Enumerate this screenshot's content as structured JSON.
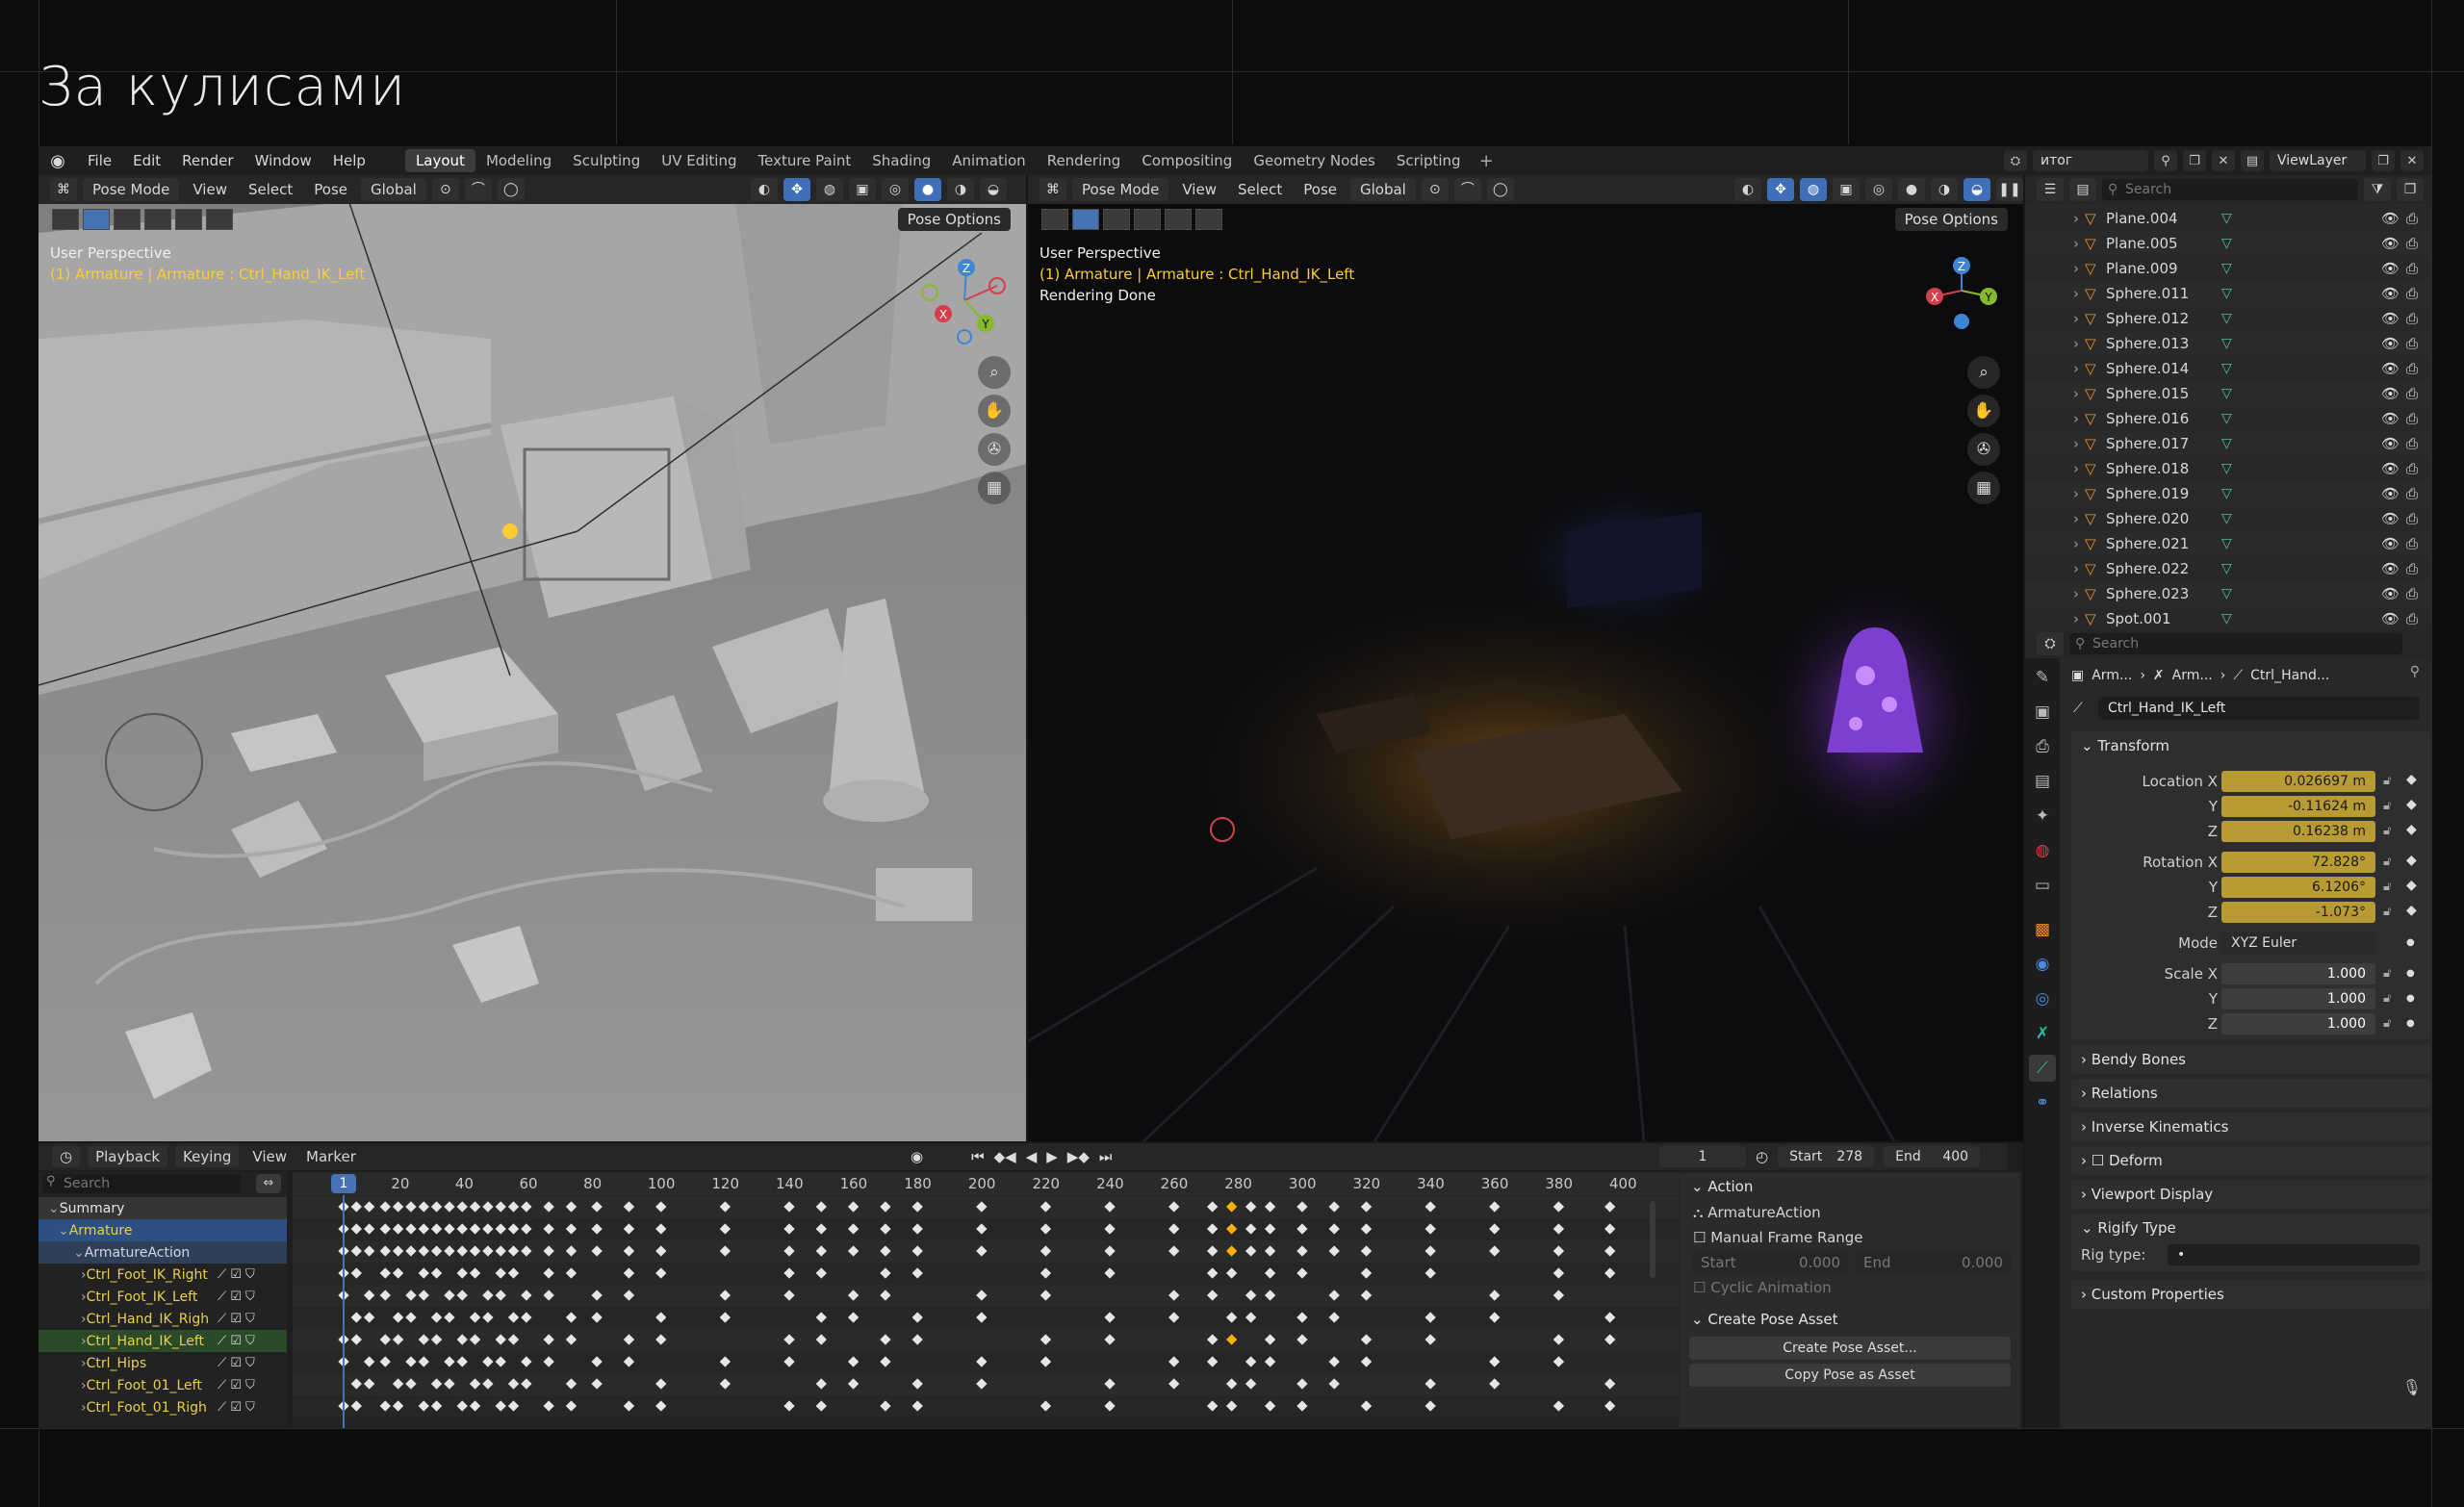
{
  "page": {
    "title": "За кулисами"
  },
  "menu": {
    "items": [
      "File",
      "Edit",
      "Render",
      "Window",
      "Help"
    ],
    "workspaces": [
      "Layout",
      "Modeling",
      "Sculpting",
      "UV Editing",
      "Texture Paint",
      "Shading",
      "Animation",
      "Rendering",
      "Compositing",
      "Geometry Nodes",
      "Scripting"
    ],
    "active_workspace": "Layout",
    "scene": "итог",
    "view_layer": "ViewLayer"
  },
  "viewport_left": {
    "mode": "Pose Mode",
    "menus": [
      "View",
      "Select",
      "Pose"
    ],
    "orientation": "Global",
    "pose_options": "Pose Options",
    "perspective": "User Perspective",
    "object_info": "(1) Armature | Armature : Ctrl_Hand_IK_Left"
  },
  "viewport_right": {
    "mode": "Pose Mode",
    "menus": [
      "View",
      "Select",
      "Pose"
    ],
    "orientation": "Global",
    "pose_options": "Pose Options",
    "perspective": "User Perspective",
    "object_info": "(1) Armature | Armature : Ctrl_Hand_IK_Left",
    "status": "Rendering Done"
  },
  "gizmo": {
    "z": "Z",
    "y": "Y",
    "x": "X",
    "colors": {
      "x": "#d33f4c",
      "y": "#86b92b",
      "z": "#3d86d6"
    }
  },
  "timeline": {
    "menus": [
      "Playback",
      "Keying",
      "View",
      "Marker"
    ],
    "current_frame": "1",
    "start_label": "Start",
    "start": "278",
    "end_label": "End",
    "end": "400",
    "search_placeholder": "Search",
    "playhead": "1",
    "ticks": [
      "20",
      "40",
      "60",
      "80",
      "100",
      "120",
      "140",
      "160",
      "180",
      "200",
      "220",
      "240",
      "260",
      "280",
      "300",
      "320",
      "340",
      "360",
      "380",
      "400"
    ],
    "channels": [
      "Summary",
      "Armature",
      "ArmatureAction",
      "Ctrl_Foot_IK_Right",
      "Ctrl_Foot_IK_Left",
      "Ctrl_Hand_IK_Righ",
      "Ctrl_Hand_IK_Left",
      "Ctrl_Hips",
      "Ctrl_Foot_01_Left",
      "Ctrl_Foot_01_Righ"
    ]
  },
  "action_panel": {
    "title": "Action",
    "action_name": "ArmatureAction",
    "manual_range": "Manual Frame Range",
    "start_label": "Start",
    "start": "0.000",
    "end_label": "End",
    "end": "0.000",
    "cyclic": "Cyclic Animation",
    "pose_asset_title": "Create Pose Asset",
    "create_pose": "Create Pose Asset...",
    "copy_pose": "Copy Pose as Asset"
  },
  "outliner": {
    "search_placeholder": "Search",
    "items": [
      "Plane.004",
      "Plane.005",
      "Plane.009",
      "Sphere.011",
      "Sphere.012",
      "Sphere.013",
      "Sphere.014",
      "Sphere.015",
      "Sphere.016",
      "Sphere.017",
      "Sphere.018",
      "Sphere.019",
      "Sphere.020",
      "Sphere.021",
      "Sphere.022",
      "Sphere.023",
      "Spot.001"
    ]
  },
  "properties": {
    "search_placeholder": "Search",
    "breadcrumb": [
      "Arm...",
      "Arm...",
      "Ctrl_Hand..."
    ],
    "bone_name": "Ctrl_Hand_IK_Left",
    "transform_title": "Transform",
    "location_label": "Location X",
    "loc_x": "0.026697 m",
    "loc_y": "-0.11624 m",
    "loc_z": "0.16238 m",
    "rotation_label": "Rotation X",
    "rot_x": "72.828°",
    "rot_y": "6.1206°",
    "rot_z": "-1.073°",
    "axis_y": "Y",
    "axis_z": "Z",
    "mode_label": "Mode",
    "mode": "XYZ Euler",
    "scale_label": "Scale X",
    "scale_x": "1.000",
    "scale_y": "1.000",
    "scale_z": "1.000",
    "sections": [
      "Bendy Bones",
      "Relations",
      "Inverse Kinematics",
      "Deform",
      "Viewport Display",
      "Rigify Type",
      "Custom Properties"
    ],
    "rig_type_label": "Rig type:",
    "rig_type": "•"
  }
}
